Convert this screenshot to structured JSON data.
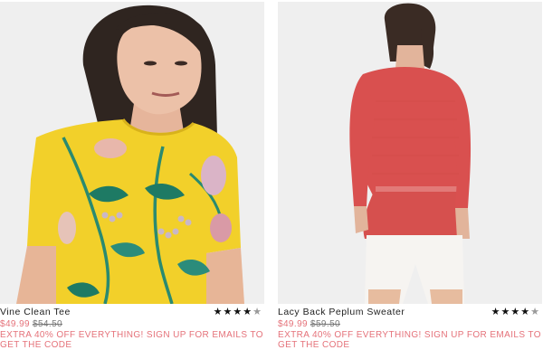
{
  "products": [
    {
      "name": "Vine Clean Tee",
      "sale_price": "$49.99",
      "original_price": "$54.50",
      "rating": 4.5,
      "promo": "EXTRA 40% OFF EVERYTHING! SIGN UP FOR EMAILS TO GET THE CODE"
    },
    {
      "name": "Lacy Back Peplum Sweater",
      "sale_price": "$49.99",
      "original_price": "$59.50",
      "rating": 4.5,
      "promo": "EXTRA 40% OFF EVERYTHING! SIGN UP FOR EMAILS TO GET THE CODE"
    }
  ],
  "colors": {
    "sale": "#e5727a",
    "tee_yellow": "#f2d02a",
    "sweater_coral": "#d9504f",
    "shorts": "#f6f4f1"
  },
  "icons": {
    "star": "star-icon",
    "half_star": "half-star-icon"
  }
}
